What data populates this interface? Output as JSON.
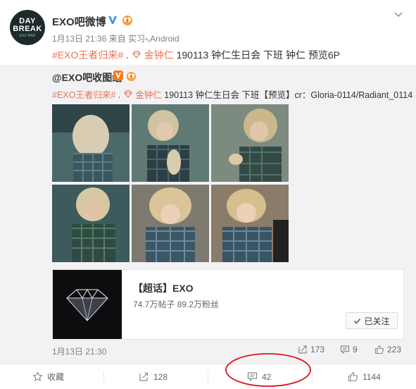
{
  "post": {
    "author": "EXO吧微博",
    "avatar_text": [
      "DAY",
      "BREAK",
      "EXO BAR"
    ],
    "meta": "1月13日 21:36 来自 实习",
    "source": "Android",
    "content_tag": "#EXO王者归来#",
    "content_location": "金钟仁",
    "content_text": "190113 钟仁生日会 下班 钟仁 预览6P"
  },
  "repost": {
    "author": "@EXO吧收图组",
    "tag": "#EXO王者归来#",
    "location": "金钟仁",
    "text": "190113 钟仁生日会 下班【预览】cr：Gloria-0114/Radiant_0114",
    "photos": [
      "photo-1",
      "photo-2",
      "photo-3",
      "photo-4",
      "photo-5",
      "photo-6"
    ],
    "card": {
      "title": "【超话】EXO",
      "stats": "74.7万帖子 89.2万粉丝",
      "follow_label": "已关注"
    },
    "time": "1月13日 21:30",
    "stats": {
      "reposts": "173",
      "comments": "9",
      "likes": "223"
    }
  },
  "actions": {
    "favorite": "收藏",
    "repost": "128",
    "comment": "42",
    "like": "1144"
  },
  "colors": {
    "accent": "#eb7350",
    "verified": "#2d97eb",
    "annotation": "#d9161c"
  }
}
